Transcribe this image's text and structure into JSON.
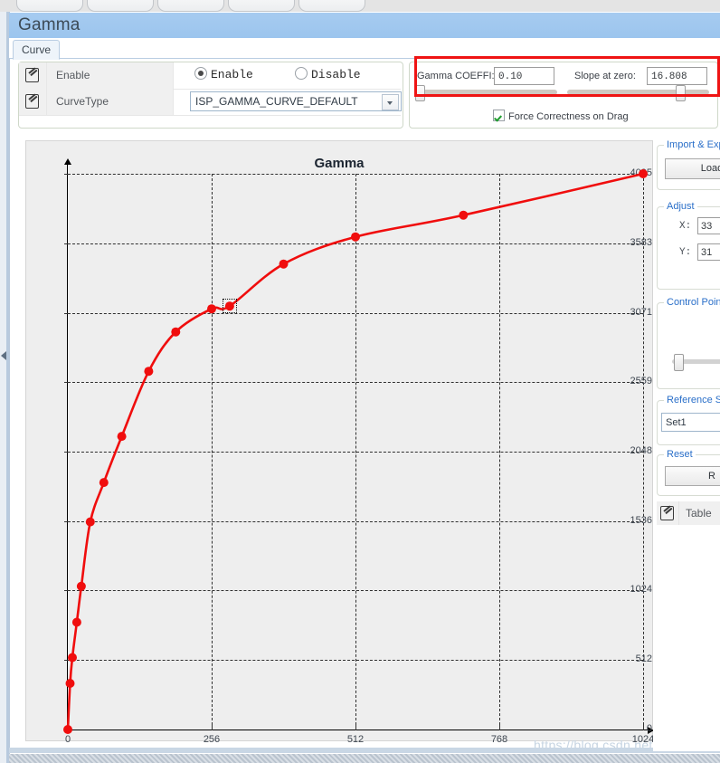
{
  "toolbar": {
    "buttons": [
      {
        "label": "",
        "left": 18,
        "width": 72
      },
      {
        "label": "",
        "left": 96,
        "width": 72
      },
      {
        "label": "",
        "left": 174,
        "width": 72
      },
      {
        "label": "",
        "left": 252,
        "width": 72
      },
      {
        "label": "",
        "left": 330,
        "width": 72
      }
    ]
  },
  "window": {
    "title": "Gamma",
    "tab": "Curve"
  },
  "form": {
    "rows": [
      {
        "label": "Enable",
        "kind": "radio"
      },
      {
        "label": "CurveType",
        "kind": "combo"
      }
    ],
    "enable_option_on": "Enable",
    "enable_option_off": "Disable",
    "curve_type_value": "ISP_GAMMA_CURVE_DEFAULT"
  },
  "params": {
    "gamma_coeff_label": "Gamma COEFFI:",
    "gamma_coeff_value": "0.10",
    "slope_label": "Slope at zero:",
    "slope_value": "16.808",
    "force_correctness_label": "Force Correctness on Drag",
    "force_correctness_checked": true,
    "highlight_color": "#ef1414"
  },
  "sidebar": {
    "groups": [
      {
        "legend": "Import & Export",
        "button": "Load"
      },
      {
        "legend": "Adjust",
        "x_label": "X:",
        "x_value": "33",
        "y_label": "Y:",
        "y_value": "31"
      },
      {
        "legend": "Control Points"
      },
      {
        "legend": "Reference Set",
        "select_value": "Set1"
      },
      {
        "legend": "Reset",
        "button": "R"
      }
    ],
    "table_button": "Table"
  },
  "watermark": "https://blog.csdn.net/rjszcb",
  "chart_data": {
    "type": "line",
    "title": "Gamma",
    "xlabel": "",
    "ylabel": "",
    "xlim": [
      0,
      1024
    ],
    "ylim": [
      0,
      4095
    ],
    "xticks": [
      0,
      256,
      512,
      768,
      1024
    ],
    "yticks": [
      0,
      512,
      1024,
      1536,
      2048,
      2559,
      3071,
      3583,
      4095
    ],
    "grid": true,
    "legend": "none",
    "line_color": "#f00d0d",
    "marker_color": "#f00d0d",
    "selected_point_index": 11,
    "points": [
      {
        "x": 0,
        "y": 0
      },
      {
        "x": 4,
        "y": 340
      },
      {
        "x": 8,
        "y": 530
      },
      {
        "x": 16,
        "y": 790
      },
      {
        "x": 24,
        "y": 1055
      },
      {
        "x": 40,
        "y": 1530
      },
      {
        "x": 64,
        "y": 1820
      },
      {
        "x": 96,
        "y": 2160
      },
      {
        "x": 144,
        "y": 2640
      },
      {
        "x": 192,
        "y": 2930
      },
      {
        "x": 256,
        "y": 3100
      },
      {
        "x": 288,
        "y": 3120
      },
      {
        "x": 384,
        "y": 3430
      },
      {
        "x": 512,
        "y": 3630
      },
      {
        "x": 704,
        "y": 3790
      },
      {
        "x": 1024,
        "y": 4095
      }
    ]
  }
}
